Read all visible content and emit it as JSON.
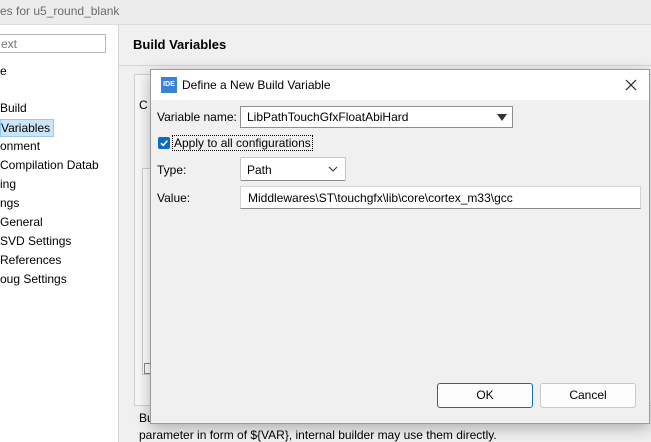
{
  "background_window": {
    "title_partial": "es for u5_round_blank",
    "filter_placeholder": "ext",
    "tree_items": [
      "e",
      "Build",
      "Variables",
      "onment",
      "Compilation Datab",
      "ing",
      "ngs",
      "General",
      "SVD Settings",
      "References",
      "oug Settings"
    ],
    "section_title": "Build Variables",
    "partial_c": "C",
    "bottom_text_1": "Bu",
    "bottom_text_2": "parameter in form of ${VAR}, internal builder may use them directly."
  },
  "dialog": {
    "icon_text": "IDE",
    "title": "Define a New Build Variable",
    "variable_name_label": "Variable name:",
    "variable_name_value": "LibPathTouchGfxFloatAbiHard",
    "apply_all_label": "Apply to all configurations",
    "apply_all_checked": true,
    "type_label": "Type:",
    "type_value": "Path",
    "value_label": "Value:",
    "value_text": "Middlewares\\ST\\touchgfx\\lib\\core\\cortex_m33\\gcc",
    "ok_label": "OK",
    "cancel_label": "Cancel"
  },
  "colors": {
    "accent": "#0f6cbd",
    "selection_bg": "#cce4f7"
  }
}
